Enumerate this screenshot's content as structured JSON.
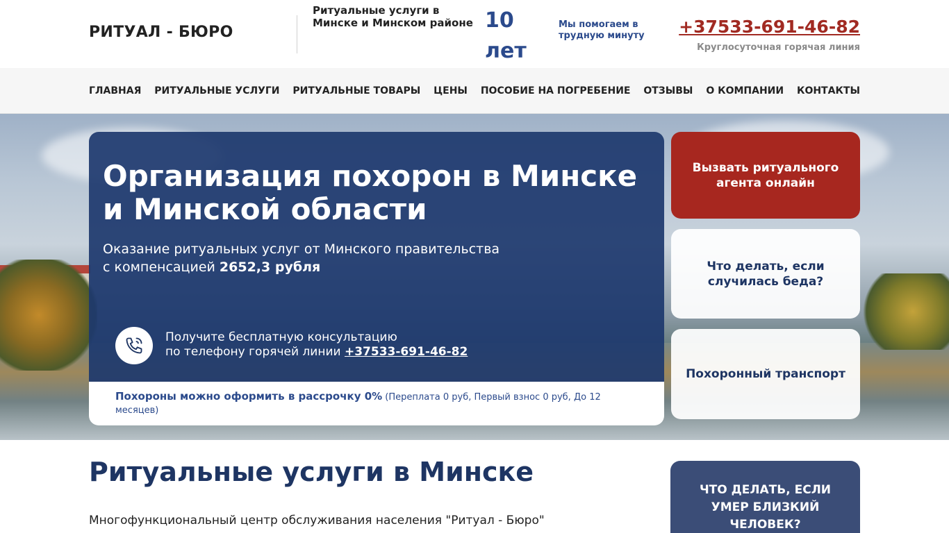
{
  "header": {
    "logo": "РИТУАЛ - БЮРО",
    "tagline": "Ритуальные услуги в Минске и Минском районе",
    "years": "10 лет",
    "help": "Мы помогаем в трудную минуту",
    "phone": "+37533-691-46-82",
    "phone_note": "Круглосуточная горячая линия"
  },
  "nav": {
    "items": [
      "ГЛАВНАЯ",
      "РИТУАЛЬНЫЕ УСЛУГИ",
      "РИТУАЛЬНЫЕ ТОВАРЫ",
      "ЦЕНЫ",
      "ПОСОБИЕ НА ПОГРЕБЕНИЕ",
      "ОТЗЫВЫ",
      "О КОМПАНИИ",
      "КОНТАКТЫ"
    ]
  },
  "hero": {
    "title": "Организация похорон в Минске и Минской области",
    "subtitle_line1": "Оказание ритуальных услуг от Минского правительства",
    "subtitle_line2": "с компенсацией ",
    "compensation": "2652,3 рубля",
    "call_line1": "Получите бесплатную консультацию",
    "call_line2": "по телефону горячей линии ",
    "call_phone": "+37533-691-46-82",
    "installment_strong": "Похороны можно оформить в рассрочку 0%",
    "installment_note": " (Переплата 0 руб, Первый взнос 0 руб, До 12 месяцев)"
  },
  "side_buttons": {
    "agent": "Вызвать ритуального агента онлайн",
    "what_to_do": "Что делать, если случилась беда?",
    "transport": "Похоронный транспорт"
  },
  "section": {
    "title": "Ритуальные услуги в Минске",
    "text": "Многофункциональный центр обслуживания населения \"Ритуал - Бюро\" предоставляет"
  },
  "sidebar": {
    "card": "ЧТО ДЕЛАТЬ, ЕСЛИ УМЕР БЛИЗКИЙ ЧЕЛОВЕК?"
  },
  "colors": {
    "brand_blue": "#1e3563",
    "accent_red": "#a7271f"
  }
}
